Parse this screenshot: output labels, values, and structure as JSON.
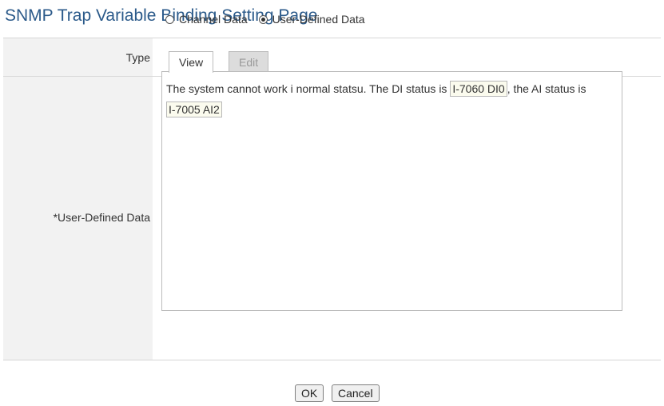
{
  "page": {
    "title": "SNMP Trap Variable Binding Setting Page"
  },
  "type_row": {
    "label": "Type",
    "options": [
      {
        "label": "Channel Data",
        "selected": false
      },
      {
        "label": "User-Defined Data",
        "selected": true
      }
    ]
  },
  "user_defined_row": {
    "label": "*User-Defined Data",
    "tabs": [
      {
        "label": "View",
        "active": true
      },
      {
        "label": "Edit",
        "active": false
      }
    ],
    "content": {
      "text1": "The system cannot work i normal statsu. The DI status is",
      "chip1": "I-7060 DI0",
      "text2": ", the AI status is",
      "chip2": "I-7005 AI2"
    }
  },
  "buttons": {
    "ok": "OK",
    "cancel": "Cancel"
  },
  "colors": {
    "title": "#2b5a8a",
    "label_background": "#f2f2f2",
    "inactive_tab": "#dcdcdc",
    "chip_background": "#fbfbee"
  }
}
